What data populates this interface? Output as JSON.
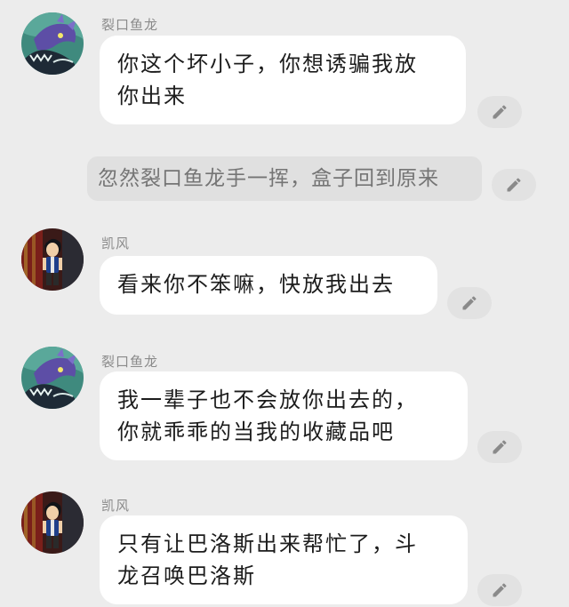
{
  "messages": [
    {
      "speaker": "裂口鱼龙",
      "lines": [
        "你这个坏小子，你想诱骗我放",
        "你出来"
      ],
      "avatar": "dragon-avatar"
    },
    {
      "narration": "忽然裂口鱼龙手一挥，盒子回到原来"
    },
    {
      "speaker": "凯风",
      "lines": [
        "看来你不笨嘛，快放我出去"
      ],
      "avatar": "boy-avatar"
    },
    {
      "speaker": "裂口鱼龙",
      "lines": [
        "我一辈子也不会放你出去的，",
        "你就乖乖的当我的收藏品吧"
      ],
      "avatar": "dragon-avatar"
    },
    {
      "speaker": "凯风",
      "lines": [
        "只有让巴洛斯出来帮忙了，斗",
        "龙召唤巴洛斯"
      ],
      "avatar": "boy-avatar"
    }
  ],
  "icons": {
    "edit": "pencil-icon"
  },
  "colors": {
    "background": "#ececec",
    "bubble": "#ffffff",
    "narration_bg": "#e0e0e0",
    "edit_button": "#e2e2e2"
  }
}
